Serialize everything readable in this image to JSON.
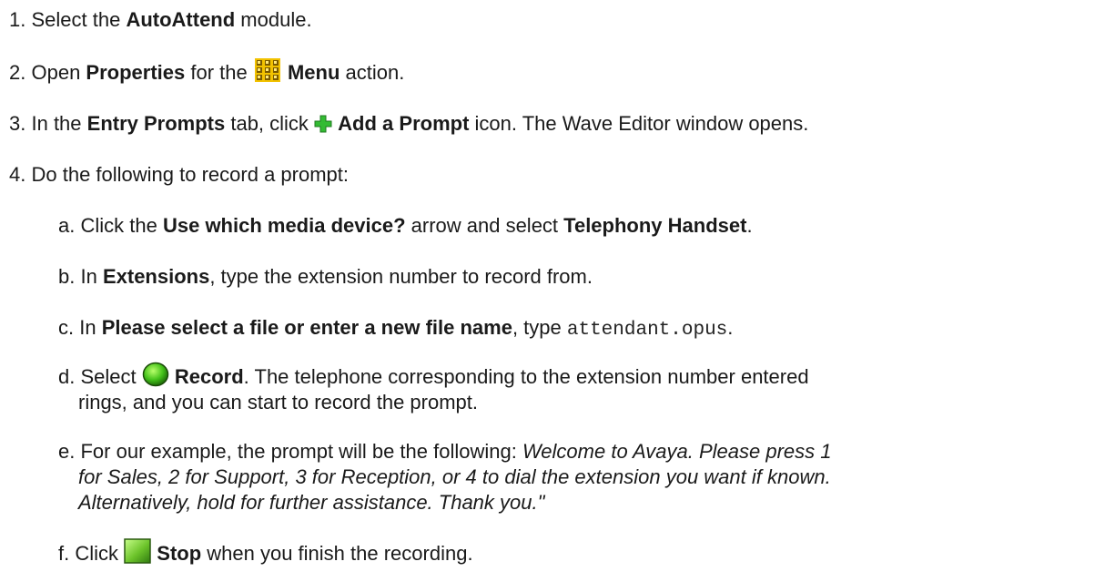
{
  "steps": [
    {
      "num": "1.",
      "pre": "Select the ",
      "bold": "AutoAttend",
      "post": " module."
    },
    {
      "num": "2.",
      "pre": "Open ",
      "bold": "Properties",
      "mid": " for the ",
      "bold2": "Menu",
      "post": " action."
    },
    {
      "num": "3.",
      "pre": "In the ",
      "bold": "Entry Prompts",
      "mid": " tab, click ",
      "bold2": "Add a Prompt",
      "post": " icon. The Wave Editor window opens."
    },
    {
      "num": "4.",
      "text": "Do the following to record a prompt:"
    }
  ],
  "substeps": {
    "a": {
      "letter": "a.",
      "pre": "Click the ",
      "bold": "Use which media device?",
      "mid": " arrow and select ",
      "bold2": "Telephony Handset",
      "post": "."
    },
    "b": {
      "letter": "b.",
      "pre": "In ",
      "bold": "Extensions",
      "post": ", type the extension number to record from."
    },
    "c": {
      "letter": "c.",
      "pre": "In ",
      "bold": "Please select a file or enter a new file name",
      "mid": ", type ",
      "code": "attendant.opus",
      "post": "."
    },
    "d": {
      "letter": "d.",
      "pre": "Select ",
      "bold": "Record",
      "post": ". The telephone corresponding to the extension number entered",
      "line2": "rings, and you can start to record the prompt."
    },
    "e": {
      "letter": "e.",
      "pre": "For our example, the prompt will be the following: ",
      "italic1": "Welcome to Avaya. Please press 1",
      "italic2": "for Sales, 2 for Support, 3 for Reception, or 4 to dial the extension you want if known.",
      "italic3": "Alternatively, hold for further assistance. Thank you.\""
    },
    "f": {
      "letter": "f.",
      "pre": "Click ",
      "bold": "Stop",
      "post": " when you finish the recording."
    }
  },
  "icons": {
    "menu": "menu-grid-icon",
    "add": "green-plus-icon",
    "record": "green-circle-record-icon",
    "stop": "green-square-stop-icon"
  },
  "colors": {
    "grid_yellow": "#f2c200",
    "grid_dark": "#7a5a00",
    "plus_green": "#33bb33",
    "record_green": "#44c21a",
    "stop_green": "#6cc32a"
  }
}
